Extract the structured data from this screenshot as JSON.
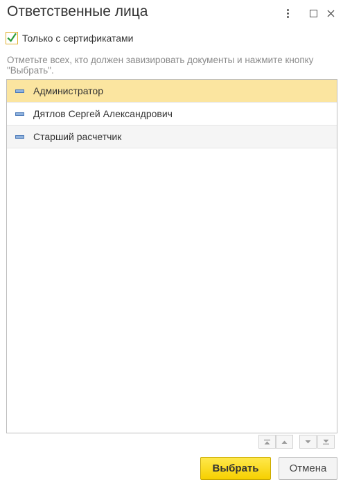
{
  "window": {
    "title": "Ответственные лица",
    "controls": [
      "more-icon",
      "maximize-icon",
      "close-icon"
    ]
  },
  "filter": {
    "checkbox_label": "Только с сертификатами",
    "checked": true
  },
  "hint": "Отметьте всех, кто должен завизировать документы и нажмите кнопку \"Выбрать\".",
  "list": {
    "items": [
      {
        "label": "Администратор",
        "selected": true
      },
      {
        "label": "Дятлов Сергей Александрович",
        "selected": false
      },
      {
        "label": "Старший расчетчик",
        "selected": false
      }
    ]
  },
  "navigation": [
    "move-first-icon",
    "move-up-icon",
    "move-down-icon",
    "move-last-icon"
  ],
  "buttons": {
    "select": "Выбрать",
    "cancel": "Отмена"
  },
  "colors": {
    "selected_row": "#fbe5a0",
    "primary_button": "#f6d000",
    "check_mark": "#2e9e3c"
  }
}
